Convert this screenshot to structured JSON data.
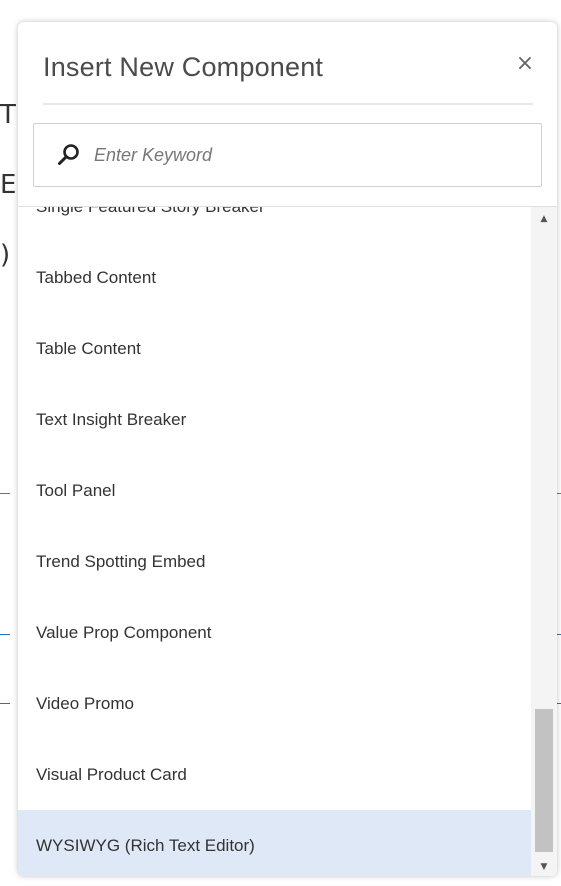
{
  "modal": {
    "title": "Insert New Component",
    "close_icon": "×"
  },
  "search": {
    "icon": "search-icon",
    "placeholder": "Enter Keyword",
    "value": ""
  },
  "components": [
    {
      "label": "Single Featured Story Breaker"
    },
    {
      "label": "Tabbed Content"
    },
    {
      "label": "Table Content"
    },
    {
      "label": "Text Insight Breaker"
    },
    {
      "label": "Tool Panel"
    },
    {
      "label": "Trend Spotting Embed"
    },
    {
      "label": "Value Prop Component"
    },
    {
      "label": "Video Promo"
    },
    {
      "label": "Visual Product Card"
    },
    {
      "label": "WYSIWYG (Rich Text Editor)",
      "selected": true
    }
  ],
  "scrollbar": {
    "up_icon": "▲",
    "down_icon": "▼"
  },
  "colors": {
    "selected_row": "#dfe8f6",
    "title_text": "#4b4b4b"
  }
}
